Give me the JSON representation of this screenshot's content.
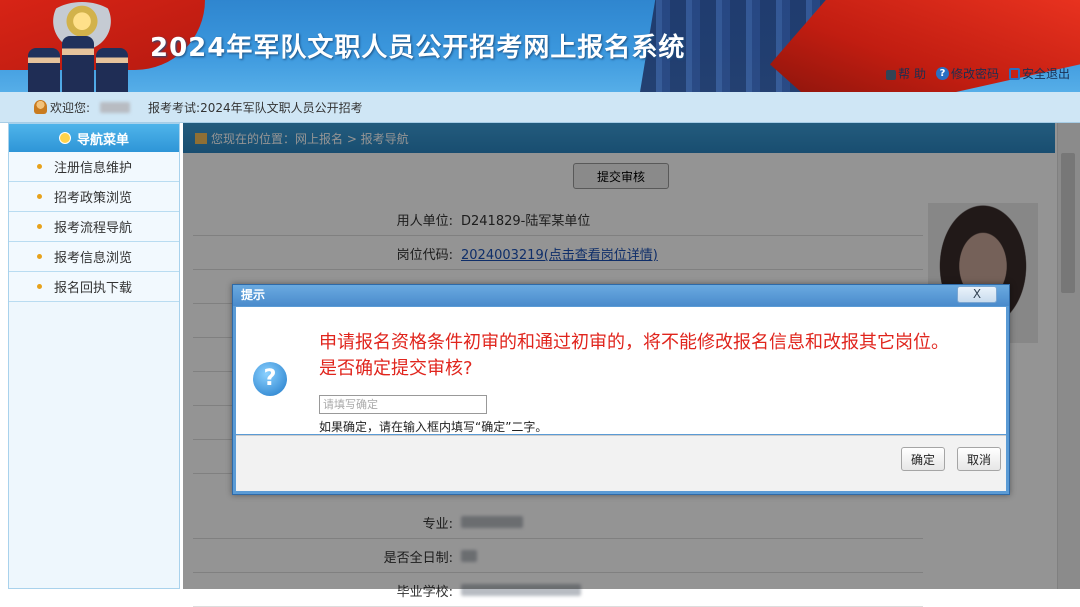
{
  "header": {
    "title": "2024年军队文职人员公开招考网上报名系统",
    "links": {
      "help": "帮 助",
      "change_password": "修改密码",
      "logout": "安全退出"
    }
  },
  "userbar": {
    "welcome": "欢迎您:",
    "exam_label": "报考考试:",
    "exam_name": "2024年军队文职人员公开招考"
  },
  "sidebar": {
    "header": "导航菜单",
    "items": [
      {
        "label": "注册信息维护"
      },
      {
        "label": "招考政策浏览"
      },
      {
        "label": "报考流程导航"
      },
      {
        "label": "报考信息浏览"
      },
      {
        "label": "报名回执下载"
      }
    ]
  },
  "main": {
    "breadcrumb": "您现在的位置：网上报名 > 报考导航",
    "submit_button": "提交审核",
    "rows": [
      {
        "label": "用人单位:",
        "value": "D241829-陆军某单位"
      },
      {
        "label": "岗位代码:",
        "value": "2024003219(点击查看岗位详情)"
      },
      {
        "label": "专业:",
        "value": ""
      },
      {
        "label": "是否全日制:",
        "value": ""
      },
      {
        "label": "毕业学校:",
        "value": ""
      }
    ]
  },
  "dialog": {
    "title": "提示",
    "close": "X",
    "message_line1": "申请报名资格条件初审的和通过初审的，将不能修改报名信息和改报其它岗位。",
    "message_line2": "是否确定提交审核?",
    "input_placeholder": "请填写确定",
    "input_value": "",
    "hint": "如果确定，请在输入框内填写“确定”二字。",
    "ok_button": "确定",
    "cancel_button": "取消"
  },
  "colors": {
    "header_blue": "#3b97dd",
    "flag_red": "#d82416",
    "dialog_message": "#e0251d",
    "nav_blue": "#2e95d7"
  }
}
